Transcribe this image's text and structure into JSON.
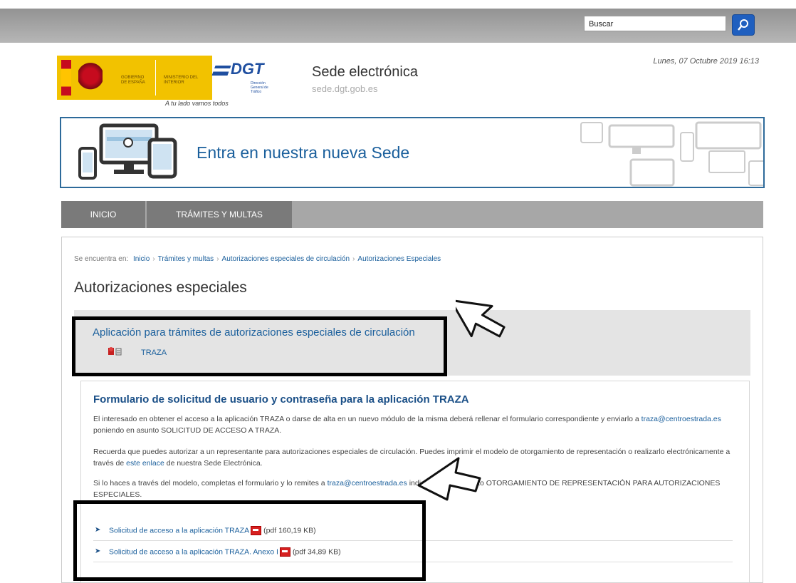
{
  "header": {
    "search_placeholder": "Buscar",
    "datetime": "Lunes, 07 Octubre 2019 16:13"
  },
  "logos": {
    "gobierno": "GOBIERNO DE ESPAÑA",
    "ministerio": "MINISTERIO DEL INTERIOR",
    "dgt": "DGT",
    "dgt_sub": "Dirección General de Tráfico",
    "tagline": "A tu lado vamos todos"
  },
  "site": {
    "title": "Sede electrónica",
    "url": "sede.dgt.gob.es"
  },
  "banner": {
    "text": "Entra en nuestra nueva Sede"
  },
  "nav": {
    "items": [
      {
        "label": "INICIO"
      },
      {
        "label": "TRÁMITES Y MULTAS"
      }
    ]
  },
  "breadcrumb": {
    "prefix": "Se encuentra en:",
    "items": [
      "Inicio",
      "Trámites y multas",
      "Autorizaciones especiales de circulación",
      "Autorizaciones Especiales"
    ]
  },
  "page": {
    "title": "Autorizaciones especiales"
  },
  "app_section": {
    "title": "Aplicación para trámites de autorizaciones especiales de circulación",
    "link": "TRAZA"
  },
  "form_section": {
    "title": "Formulario de solicitud de usuario y contraseña para la aplicación TRAZA",
    "p1_a": "El interesado en obtener el acceso a la aplicación TRAZA o darse de alta en un nuevo módulo de la misma deberá rellenar el formulario correspondiente y enviarlo a ",
    "p1_email": "traza@centroestrada.es",
    "p1_b": " poniendo en asunto SOLICITUD DE ACCESO A TRAZA.",
    "p2_a": "Recuerda que puedes autorizar a un representante para autorizaciones especiales de circulación. Puedes imprimir el modelo de otorgamiento de representación o realizarlo electrónicamente a través de ",
    "p2_link": "este enlace",
    "p2_b": " de nuestra Sede Electrónica.",
    "p3_a": "Si lo haces a través del modelo, completas el formulario y lo remites a ",
    "p3_email": "traza@centroestrada.es",
    "p3_b": " indicando en el asunto OTORGAMIENTO DE REPRESENTACIÓN PARA AUTORIZACIONES ESPECIALES.",
    "downloads": [
      {
        "label": "Solicitud de acceso a la aplicación TRAZA",
        "size": "(pdf 160,19 KB)"
      },
      {
        "label": "Solicitud de acceso a la aplicación TRAZA. Anexo I",
        "size": "(pdf 34,89 KB)"
      }
    ]
  }
}
